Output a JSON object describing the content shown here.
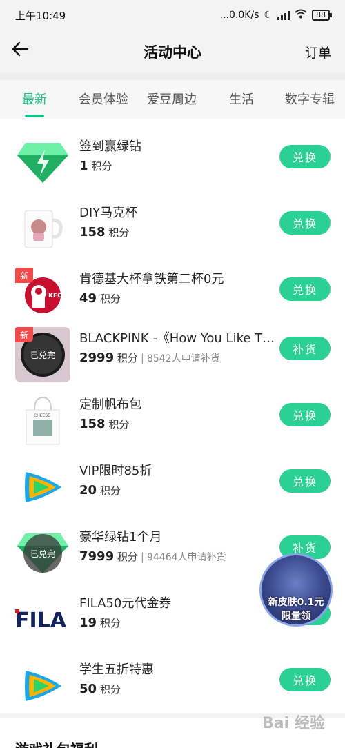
{
  "status_bar": {
    "time": "上午10:49",
    "speed": "...0.0K/s",
    "battery": "88"
  },
  "header": {
    "title": "活动中心",
    "order_label": "订单"
  },
  "tabs": [
    {
      "label": "最新",
      "active": true
    },
    {
      "label": "会员体验",
      "active": false
    },
    {
      "label": "爱豆周边",
      "active": false
    },
    {
      "label": "生活",
      "active": false
    },
    {
      "label": "数字专辑",
      "active": false
    }
  ],
  "points_unit": "积分",
  "items": [
    {
      "title": "签到赢绿钻",
      "points": "1",
      "button": "兑换",
      "icon": "green-diamond-icon"
    },
    {
      "title": "DIY马克杯",
      "points": "158",
      "button": "兑换",
      "icon": "mug-icon"
    },
    {
      "title": "肯德基大杯拿铁第二杯0元",
      "points": "49",
      "button": "兑换",
      "icon": "kfc-logo",
      "badge": "新"
    },
    {
      "title": "BLACKPINK -《How You Like That》",
      "points": "2999",
      "button": "补货",
      "icon": "album-icon",
      "badge": "新",
      "soldout": "已兑完",
      "requests": "8542人申请补货"
    },
    {
      "title": "定制帆布包",
      "points": "158",
      "button": "兑换",
      "icon": "tote-bag-icon"
    },
    {
      "title": "VIP限时85折",
      "points": "20",
      "button": "兑换",
      "icon": "play-logo-icon"
    },
    {
      "title": "豪华绿钻1个月",
      "points": "7999",
      "button": "补货",
      "icon": "green-diamond-icon",
      "soldout": "已兑完",
      "requests": "94464人申请补货"
    },
    {
      "title": "FILA50元代金券",
      "points": "19",
      "button": "兑换",
      "icon": "fila-logo"
    },
    {
      "title": "学生五折特惠",
      "points": "50",
      "button": "兑换",
      "icon": "play-logo-icon"
    }
  ],
  "bottom_section_title": "游戏礼包福利",
  "float_ad": {
    "line1": "新皮肤0.1元",
    "line2": "限量领"
  },
  "watermark": "Bai 经验",
  "colors": {
    "accent": "#19c28a",
    "button": "#2bd194",
    "badge": "#f04b4b"
  }
}
